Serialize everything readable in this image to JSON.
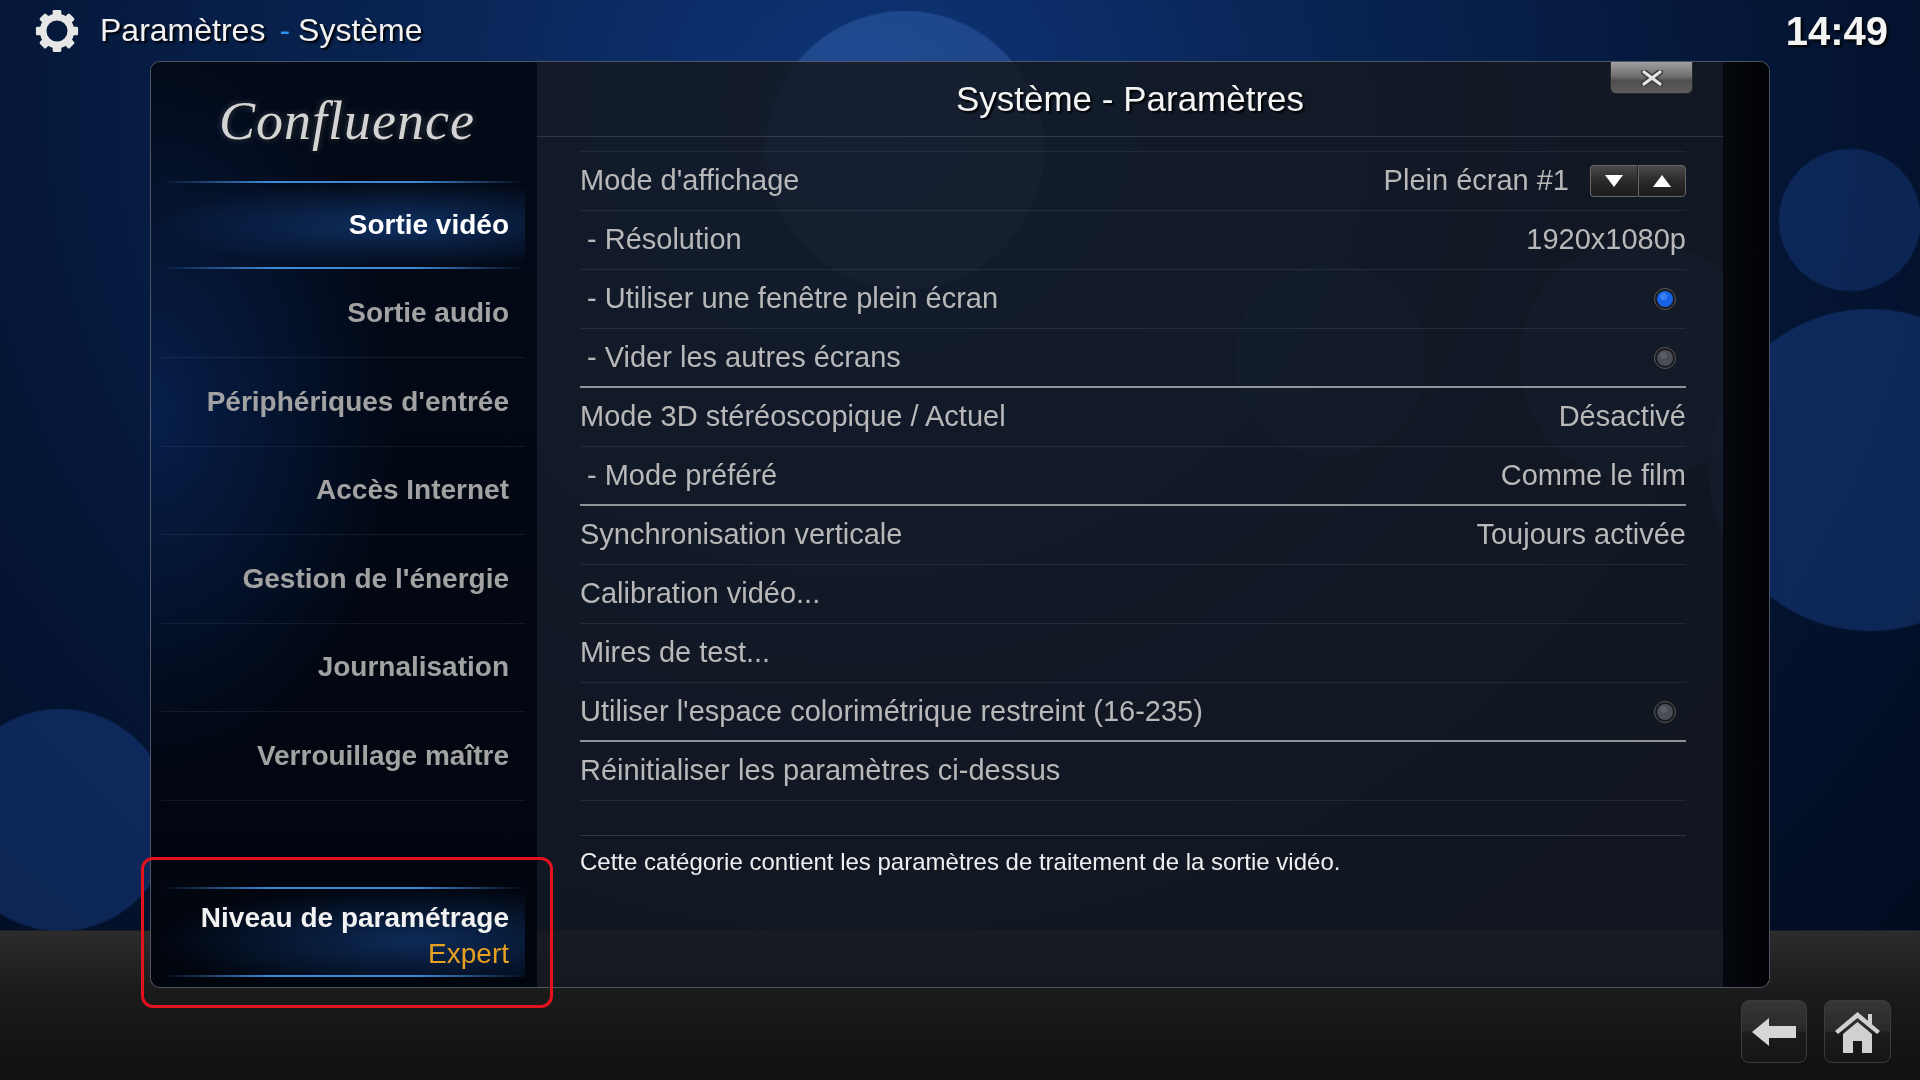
{
  "header": {
    "title": "Paramètres",
    "separator": "-",
    "subtitle": "Système",
    "clock": "14:49"
  },
  "sidebar": {
    "logo": "Confluence",
    "items": [
      {
        "label": "Sortie vidéo",
        "selected": true
      },
      {
        "label": "Sortie audio",
        "selected": false
      },
      {
        "label": "Périphériques d'entrée",
        "selected": false
      },
      {
        "label": "Accès Internet",
        "selected": false
      },
      {
        "label": "Gestion de l'énergie",
        "selected": false
      },
      {
        "label": "Journalisation",
        "selected": false
      },
      {
        "label": "Verrouillage maître",
        "selected": false
      }
    ],
    "settings_level": {
      "label": "Niveau de paramétrage",
      "value": "Expert",
      "highlighted": true
    }
  },
  "dialog": {
    "title": "Système - Paramètres",
    "groups": [
      {
        "rows": [
          {
            "kind": "spin",
            "label": "Mode d'affichage",
            "value": "Plein écran #1",
            "children": [
              {
                "kind": "value",
                "label": "- Résolution",
                "value": "1920x1080p"
              },
              {
                "kind": "toggle",
                "label": "- Utiliser une fenêtre plein écran",
                "on": true
              },
              {
                "kind": "toggle",
                "label": "- Vider les autres écrans",
                "on": false
              }
            ]
          }
        ]
      },
      {
        "rows": [
          {
            "kind": "value",
            "label": "Mode 3D stéréoscopique / Actuel",
            "value": "Désactivé",
            "children": [
              {
                "kind": "value",
                "label": "- Mode préféré",
                "value": "Comme le film"
              }
            ]
          }
        ]
      },
      {
        "rows": [
          {
            "kind": "value",
            "label": "Synchronisation verticale",
            "value": "Toujours activée"
          },
          {
            "kind": "action",
            "label": "Calibration vidéo..."
          },
          {
            "kind": "action",
            "label": "Mires de test..."
          },
          {
            "kind": "toggle",
            "label": "Utiliser l'espace colorimétrique restreint (16-235)",
            "on": false
          }
        ]
      },
      {
        "rows": [
          {
            "kind": "action",
            "label": "Réinitialiser les paramètres ci-dessus"
          }
        ]
      }
    ],
    "description": "Cette catégorie contient les paramètres de traitement de la sortie vidéo."
  }
}
